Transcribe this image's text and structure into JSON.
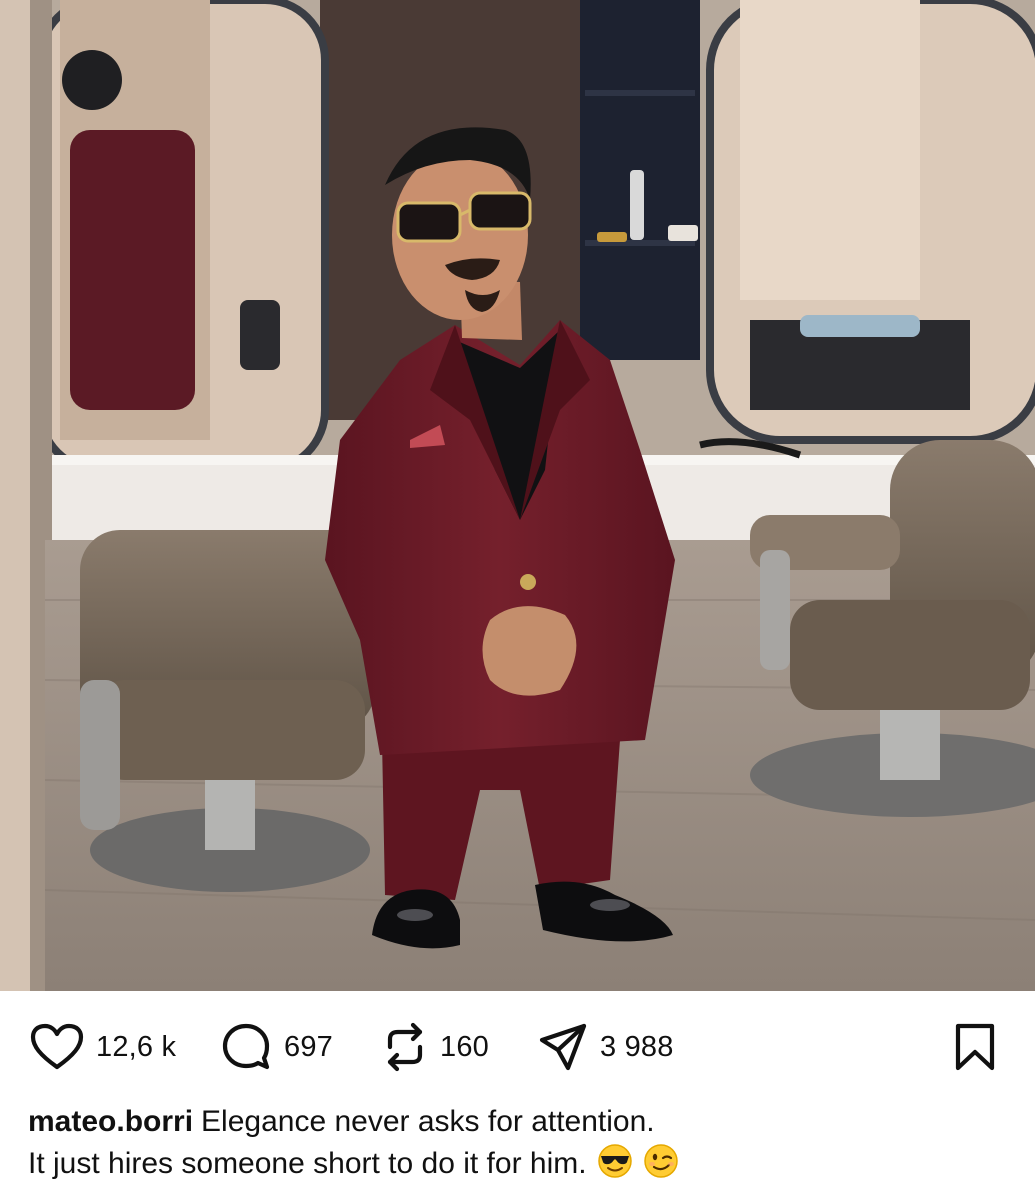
{
  "post": {
    "image_alt": "Man in burgundy suit and sunglasses standing in a hair salon",
    "actions": {
      "like": {
        "icon": "heart-icon",
        "count": "12,6 k"
      },
      "comment": {
        "icon": "comment-bubble-icon",
        "count": "697"
      },
      "repost": {
        "icon": "repost-icon",
        "count": "160"
      },
      "share": {
        "icon": "send-icon",
        "count": "3 988"
      },
      "save": {
        "icon": "bookmark-icon"
      }
    },
    "caption": {
      "username": "mateo.borri",
      "line1": "Elegance never asks for attention.",
      "line2": "It just hires someone short to do it for him.",
      "emojis": [
        "smiling-face-with-sunglasses-emoji",
        "winking-face-emoji"
      ]
    }
  },
  "colors": {
    "text": "#111111",
    "background": "#ffffff",
    "suit": "#6e1a24"
  }
}
